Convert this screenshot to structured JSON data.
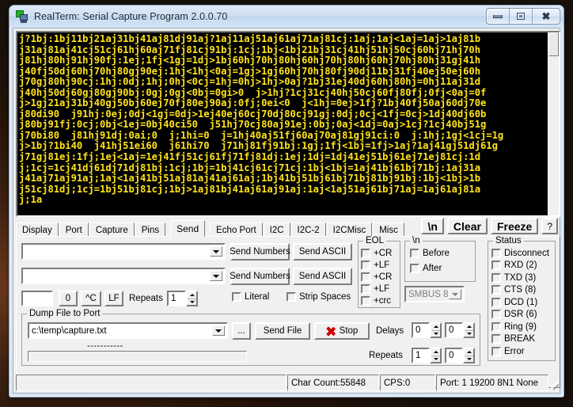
{
  "window": {
    "title": "RealTerm: Serial Capture Program 2.0.0.70",
    "icon": "computer-monitor-icon",
    "minimize_label": "–",
    "maximize_label": "□",
    "close_label": "✕"
  },
  "terminal": {
    "fg_color": "#ffe31a",
    "bg_color": "#000000",
    "lines": [
      "j?1bj:1bj11bj21aj31bj41aj81dj91aj?1aj11aj51aj61aj71aj81cj:1aj;1aj<1aj=1aj>1aj81b",
      "j31aj81aj41cj51cj61hj60aj71fj81cj91bj:1cj;1bj<1bj21bj31cj41hj51hj50cj60hj71hj70h",
      "j81hj80hj91hj90fj:1ej;1fj<1gj=1dj>1bj60hj70hj80hj60hj70hj80hj60hj70hj80hj31gj41h",
      "j40fj50dj60hj70hj80gj90ej:1hj<1hj<0aj=1gj>1gj60hj70hj80fj90dj11bj31fj40ej50ej60h",
      "j70gj80hj90cj:1hj:0dj;1hj;0hj<0cj=1hj=0hj>1hj>0aj?1bj31ej40dj60hj80hj=0hj11aj31d",
      "j40hj50dj60gj80gj90bj:0gj;0gj<0bj=0gi>0  j>1hj?1cj31cj40hj50cj60fj80fj;0fj<0aj=0f",
      "j>1gj21aj31bj40gj50bj60ej70fj80ej90aj:0fj;0ei<0  j<1hj=0ej>1fj?1bj40fj50aj60dj70e",
      "j80di90  j91hj:0ej;0dj<1gj=0dj>1ej40ej60cj70dj80cj91gj:0dj;0cj<1fj=0cj>1dj40dj60b",
      "j80bj91fj:0cj;0bj<1ej=0bj40ci50  j51hj70cj80aj91ej:0bj;0aj<1dj=0aj>1cj?1cj40bj51g",
      "j70bi80  j81hj91dj:0ai;0  j;1hi=0  j=1hj40aj51fj60aj70aj81gj91ci:0  j:1hj;1gj<1cj=1g",
      "j>1bj?1bi40  j41hj51ei60  j61hi70  j71hj81fj91bj:1gj;1fj<1bj=1fj>1aj?1aj41gj51dj61g",
      "j71gj81ej:1fj;1ej<1aj=1ej41fj51cj61fj71fj81dj:1ej;1dj=1dj41ej51bj61ej71ej81cj:1d",
      "j;1cj=1cj41dj61dj71dj81bj:1cj;1bj=1bj41cj61cj71cj:1bj<1bj=1aj41bj61bj71bj:1aj31a",
      "j41aj71aj91aj;1aj<1aj41bj51aj81aj41aj61aj;1bj41bj51bj61bj71bj81bj91bj:1bj<1bj>1b",
      "j51cj81dj;1cj=1bj51bj81cj;1bj>1aj81bj41aj61aj91aj:1aj<1aj51aj61bj71aj=1aj61aj81a",
      "j;1a"
    ]
  },
  "tabs": [
    {
      "label": "Display",
      "active": false
    },
    {
      "label": "Port",
      "active": false
    },
    {
      "label": "Capture",
      "active": false
    },
    {
      "label": "Pins",
      "active": false
    },
    {
      "label": "Send",
      "active": true
    },
    {
      "label": "Echo Port",
      "active": false
    },
    {
      "label": "I2C",
      "active": false
    },
    {
      "label": "I2C-2",
      "active": false
    },
    {
      "label": "I2CMisc",
      "active": false
    },
    {
      "label": "Misc",
      "active": false
    }
  ],
  "toolbar": {
    "newline_label": "\\n",
    "clear_label": "Clear",
    "freeze_label": "Freeze",
    "help_label": "?"
  },
  "send": {
    "row1": {
      "combo_value": "",
      "send_numbers_label": "Send Numbers",
      "send_ascii_label": "Send ASCII"
    },
    "row2": {
      "combo_value": "",
      "send_numbers_label": "Send Numbers",
      "send_ascii_label": "Send ASCII"
    },
    "row3": {
      "textbox_value": "",
      "zero_label": "0",
      "ctrlc_label": "^C",
      "lf_label": "LF",
      "repeats_label": "Repeats",
      "repeats_value": "1"
    },
    "literal_label": "Literal",
    "strip_spaces_label": "Strip Spaces",
    "literal_checked": false,
    "strip_spaces_checked": false
  },
  "eol": {
    "title": "EOL",
    "items": [
      {
        "label": "+CR",
        "checked": false
      },
      {
        "label": "+LF",
        "checked": false
      },
      {
        "label": "+CR",
        "checked": false
      },
      {
        "label": "+LF",
        "checked": false
      },
      {
        "label": "+crc",
        "checked": false
      }
    ]
  },
  "newline_group": {
    "title": "\\n",
    "before_label": "Before",
    "after_label": "After",
    "before_checked": false,
    "after_checked": false,
    "crc_combo_value": "SMBUS 8"
  },
  "dump": {
    "title": "Dump File to Port",
    "file_path": "c:\\temp\\capture.txt",
    "browse_label": "...",
    "send_file_label": "Send File",
    "stop_label": "Stop",
    "delays_label": "Delays",
    "delay1_value": "0",
    "delay2_value": "0",
    "repeats_label": "Repeats",
    "repeats1_value": "1",
    "repeats2_value": "0",
    "progress_dashes": "-----------"
  },
  "status_group": {
    "title": "Status",
    "items": [
      {
        "label": "Disconnect",
        "checked": false
      },
      {
        "label": "RXD (2)",
        "checked": false
      },
      {
        "label": "TXD (3)",
        "checked": false
      },
      {
        "label": "CTS (8)",
        "checked": false
      },
      {
        "label": "DCD (1)",
        "checked": false
      },
      {
        "label": "DSR (6)",
        "checked": false
      },
      {
        "label": "Ring (9)",
        "checked": false
      },
      {
        "label": "BREAK",
        "checked": false
      },
      {
        "label": "Error",
        "checked": false
      }
    ]
  },
  "statusbar": {
    "message": "",
    "char_count": "Char Count:55848",
    "cps": "CPS:0",
    "port": "Port: 1 19200 8N1 None"
  }
}
